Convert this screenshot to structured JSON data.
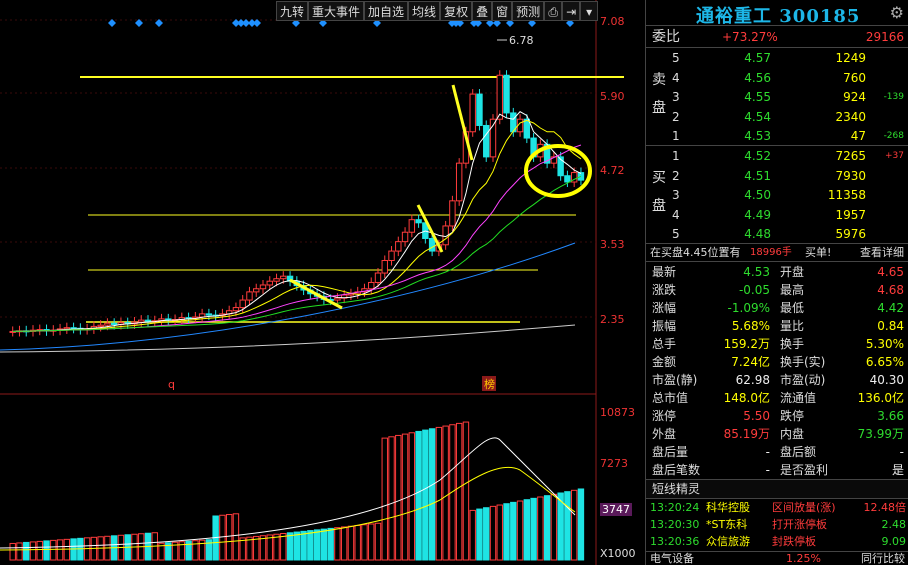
{
  "toolbar": [
    "九转",
    "重大事件",
    "加自选",
    "均线",
    "复权",
    "叠",
    "窗",
    "预测"
  ],
  "toolbar_icons": [
    "share-icon",
    "pin-icon",
    "dropdown-icon"
  ],
  "price_axis": [
    "7.08",
    "5.90",
    "4.72",
    "3.53",
    "2.35"
  ],
  "volume_axis": [
    "10873",
    "7273",
    "3747",
    "X1000"
  ],
  "chart_labels": {
    "high": "6.78",
    "marker_q": "q",
    "marker_bang": "榜"
  },
  "panel": {
    "title": "通裕重工 300185",
    "webi": {
      "label": "委比",
      "pct": "+73.27%",
      "diff": "29166"
    },
    "sell_side_label": [
      "卖",
      "盘"
    ],
    "buy_side_label": [
      "买",
      "盘"
    ],
    "sell": [
      {
        "lv": "5",
        "price": "4.57",
        "vol": "1249",
        "chg": ""
      },
      {
        "lv": "4",
        "price": "4.56",
        "vol": "760",
        "chg": ""
      },
      {
        "lv": "3",
        "price": "4.55",
        "vol": "924",
        "chg": "-139"
      },
      {
        "lv": "2",
        "price": "4.54",
        "vol": "2340",
        "chg": ""
      },
      {
        "lv": "1",
        "price": "4.53",
        "vol": "47",
        "chg": "-268"
      }
    ],
    "buy": [
      {
        "lv": "1",
        "price": "4.52",
        "vol": "7265",
        "chg": "+37"
      },
      {
        "lv": "2",
        "price": "4.51",
        "vol": "7930",
        "chg": ""
      },
      {
        "lv": "3",
        "price": "4.50",
        "vol": "11358",
        "chg": ""
      },
      {
        "lv": "4",
        "price": "4.49",
        "vol": "1957",
        "chg": ""
      },
      {
        "lv": "5",
        "price": "4.48",
        "vol": "5976",
        "chg": ""
      }
    ],
    "position": {
      "pre": "在买盘4.45位置有",
      "amount": "18996手",
      "post": "买单!",
      "detail": "查看详细"
    },
    "stats": [
      {
        "k": "最新",
        "v": "4.53",
        "c": "green",
        "k2": "开盘",
        "v2": "4.65",
        "c2": "red"
      },
      {
        "k": "涨跌",
        "v": "-0.05",
        "c": "green",
        "k2": "最高",
        "v2": "4.68",
        "c2": "red"
      },
      {
        "k": "涨幅",
        "v": "-1.09%",
        "c": "green",
        "k2": "最低",
        "v2": "4.42",
        "c2": "green"
      },
      {
        "k": "振幅",
        "v": "5.68%",
        "c": "yellow",
        "k2": "量比",
        "v2": "0.84",
        "c2": "yellow"
      },
      {
        "k": "总手",
        "v": "159.2万",
        "c": "yellow",
        "k2": "换手",
        "v2": "5.30%",
        "c2": "yellow"
      },
      {
        "k": "金额",
        "v": "7.24亿",
        "c": "yellow",
        "k2": "换手(实)",
        "v2": "6.65%",
        "c2": "yellow"
      },
      {
        "k": "市盈(静)",
        "v": "62.98",
        "c": "white",
        "k2": "市盈(动)",
        "v2": "40.30",
        "c2": "white"
      },
      {
        "k": "总市值",
        "v": "148.0亿",
        "c": "yellow",
        "k2": "流通值",
        "v2": "136.0亿",
        "c2": "yellow"
      },
      {
        "k": "涨停",
        "v": "5.50",
        "c": "red",
        "k2": "跌停",
        "v2": "3.66",
        "c2": "green"
      },
      {
        "k": "外盘",
        "v": "85.19万",
        "c": "red",
        "k2": "内盘",
        "v2": "73.99万",
        "c2": "green"
      },
      {
        "k": "盘后量",
        "v": "-",
        "c": "white",
        "k2": "盘后额",
        "v2": "-",
        "c2": "white"
      },
      {
        "k": "盘后笔数",
        "v": "-",
        "c": "white",
        "k2": "是否盈利",
        "v2": "是",
        "c2": "white"
      }
    ],
    "ticker_title": "短线精灵",
    "ticker": [
      {
        "time": "13:20:24",
        "name": "科华控股",
        "event": "区间放量(涨)",
        "val": "12.48倍"
      },
      {
        "time": "13:20:30",
        "name": "*ST东科",
        "event": "打开涨停板",
        "val": "2.48"
      },
      {
        "time": "13:20:36",
        "name": "众信旅游",
        "event": "封跌停板",
        "val": "9.09"
      }
    ],
    "bottom": {
      "sector": "电气设备",
      "pct": "1.25%",
      "compare": "同行比较"
    }
  },
  "colors": {
    "up": "#ff3c3c",
    "down": "#1ee4e4",
    "ma5": "#ffffff",
    "ma10": "#ffff00",
    "ma20": "#ff44ff",
    "ma30": "#22dd22",
    "ma60": "#2288ff",
    "ma120": "#cccccc",
    "accent": "#1db7e8"
  }
}
